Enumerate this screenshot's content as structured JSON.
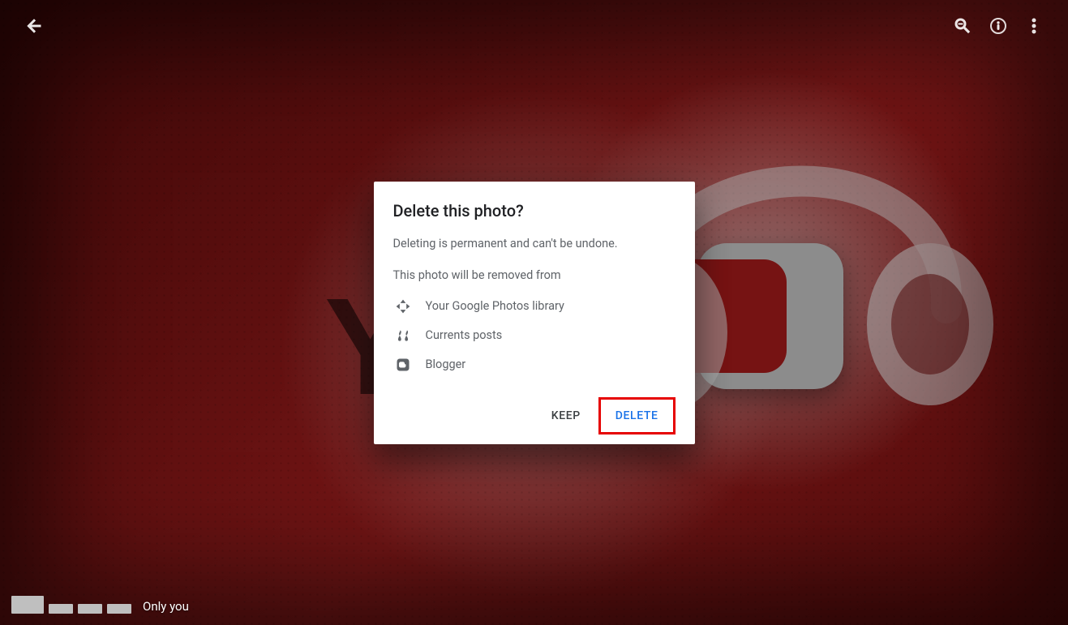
{
  "toolbar": {
    "back_name": "back",
    "zoom_name": "zoom-out",
    "info_name": "info",
    "more_name": "more-options"
  },
  "dialog": {
    "title": "Delete this photo?",
    "warning": "Deleting is permanent and can't be undone.",
    "removal_intro": "This photo will be removed from",
    "items": [
      {
        "icon": "photos-icon",
        "label": "Your Google Photos library"
      },
      {
        "icon": "currents-icon",
        "label": "Currents posts"
      },
      {
        "icon": "blogger-icon",
        "label": "Blogger"
      }
    ],
    "keep_label": "Keep",
    "delete_label": "Delete"
  },
  "footer": {
    "visibility": "Only you"
  }
}
